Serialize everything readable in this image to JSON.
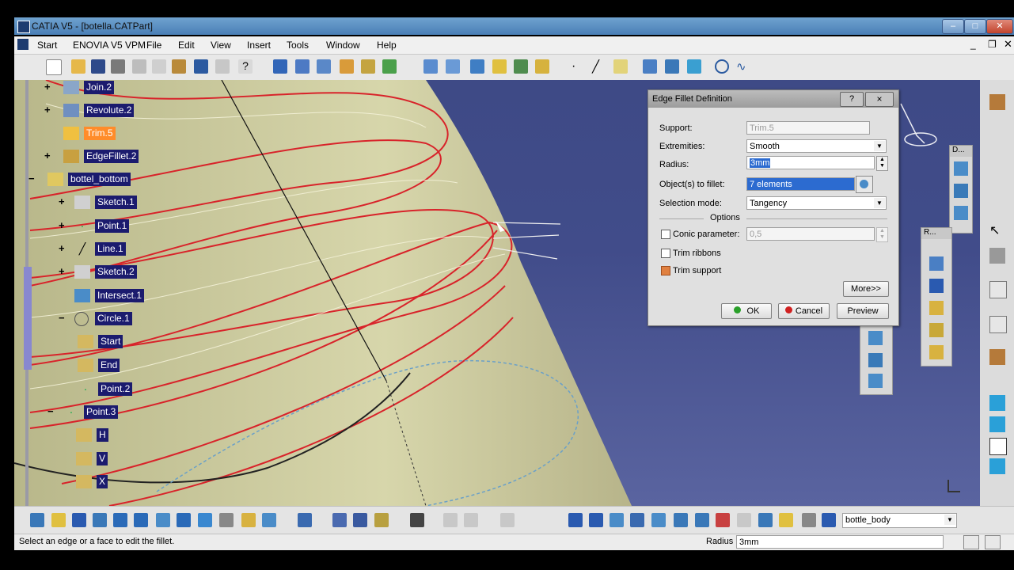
{
  "window": {
    "title": "CATIA V5 - [botella.CATPart]"
  },
  "menu": [
    "Start",
    "ENOVIA V5 VPM",
    "File",
    "Edit",
    "View",
    "Insert",
    "Tools",
    "Window",
    "Help"
  ],
  "tree": [
    {
      "label": "Join.2",
      "selected": false
    },
    {
      "label": "Revolute.2",
      "selected": false
    },
    {
      "label": "Trim.5",
      "selected": true
    },
    {
      "label": "EdgeFillet.2",
      "selected": false
    },
    {
      "label": "bottel_bottom",
      "selected": false
    },
    {
      "label": "Sketch.1",
      "selected": false
    },
    {
      "label": "Point.1",
      "selected": false
    },
    {
      "label": "Line.1",
      "selected": false
    },
    {
      "label": "Sketch.2",
      "selected": false
    },
    {
      "label": "Intersect.1",
      "selected": false
    },
    {
      "label": "Circle.1",
      "selected": false
    },
    {
      "label": "Start",
      "selected": false
    },
    {
      "label": "End",
      "selected": false
    },
    {
      "label": "Point.2",
      "selected": false
    },
    {
      "label": "Point.3",
      "selected": false
    },
    {
      "label": "H",
      "selected": false
    },
    {
      "label": "V",
      "selected": false
    },
    {
      "label": "X",
      "selected": false
    }
  ],
  "dialog": {
    "title": "Edge Fillet Definition",
    "help": "?",
    "close": "×",
    "support_label": "Support:",
    "support_value": "Trim.5",
    "extremities_label": "Extremities:",
    "extremities_value": "Smooth",
    "radius_label": "Radius:",
    "radius_value": "3mm",
    "objects_label": "Object(s) to fillet:",
    "objects_value": "7 elements",
    "selection_label": "Selection mode:",
    "selection_value": "Tangency",
    "options_label": "Options",
    "conic_label": "Conic parameter:",
    "conic_value": "0,5",
    "conic_checked": false,
    "trim_ribbons_label": "Trim ribbons",
    "trim_ribbons_checked": false,
    "trim_support_label": "Trim support",
    "trim_support_checked": true,
    "more_label": "More>>",
    "ok_label": "OK",
    "cancel_label": "Cancel",
    "preview_label": "Preview"
  },
  "mini_toolbars": {
    "d_caption": "D...",
    "r_caption": "R..."
  },
  "bottom": {
    "body_select": "bottle_body"
  },
  "status": {
    "message": "Select an edge or a face to edit the fillet.",
    "radius_label": "Radius",
    "radius_value": "3mm"
  },
  "colors": {
    "accent": "#1b1b6e",
    "selection": "#ff8c2a",
    "curve": "#d8232a",
    "surface": "#c9c79a"
  }
}
